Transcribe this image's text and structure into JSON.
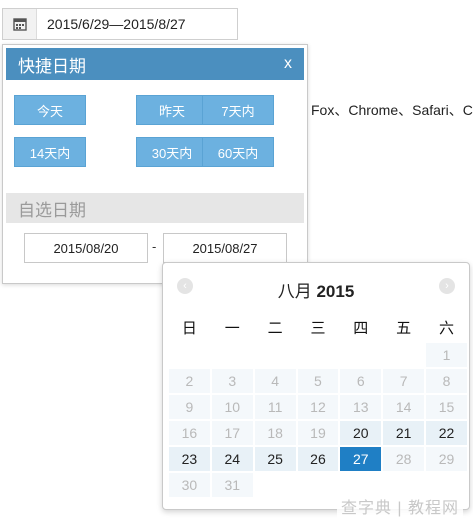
{
  "range_input": {
    "icon": "calendar-icon",
    "value": "2015/6/29—2015/8/27"
  },
  "bg_text": "Fox、Chrome、Safari、C",
  "quick": {
    "title": "快捷日期",
    "close": "x",
    "buttons": [
      "今天",
      "昨天",
      "7天内",
      "14天内",
      "30天内",
      "60天内"
    ],
    "custom_title": "自选日期",
    "start_date": "2015/08/20",
    "separator": "-",
    "end_date": "2015/08/27"
  },
  "calendar": {
    "month": "八月",
    "year": "2015",
    "prev": "‹",
    "next": "›",
    "weekdays": [
      "日",
      "一",
      "二",
      "三",
      "四",
      "五",
      "六"
    ],
    "rows": [
      [
        "",
        "",
        "",
        "",
        "",
        "",
        "1"
      ],
      [
        "2",
        "3",
        "4",
        "5",
        "6",
        "7",
        "8"
      ],
      [
        "9",
        "10",
        "11",
        "12",
        "13",
        "14",
        "15"
      ],
      [
        "16",
        "17",
        "18",
        "19",
        "20",
        "21",
        "22"
      ],
      [
        "23",
        "24",
        "25",
        "26",
        "27",
        "28",
        "29"
      ],
      [
        "30",
        "31",
        "",
        "",
        "",
        "",
        ""
      ]
    ],
    "active_days": [
      "20",
      "21",
      "22",
      "23",
      "24",
      "25",
      "26"
    ],
    "selected_day": "27",
    "accent_color": "#1f7fc5",
    "header_color": "#4b8fbf",
    "button_color": "#6cb1e0"
  },
  "watermark": "查字典 | 教程网"
}
